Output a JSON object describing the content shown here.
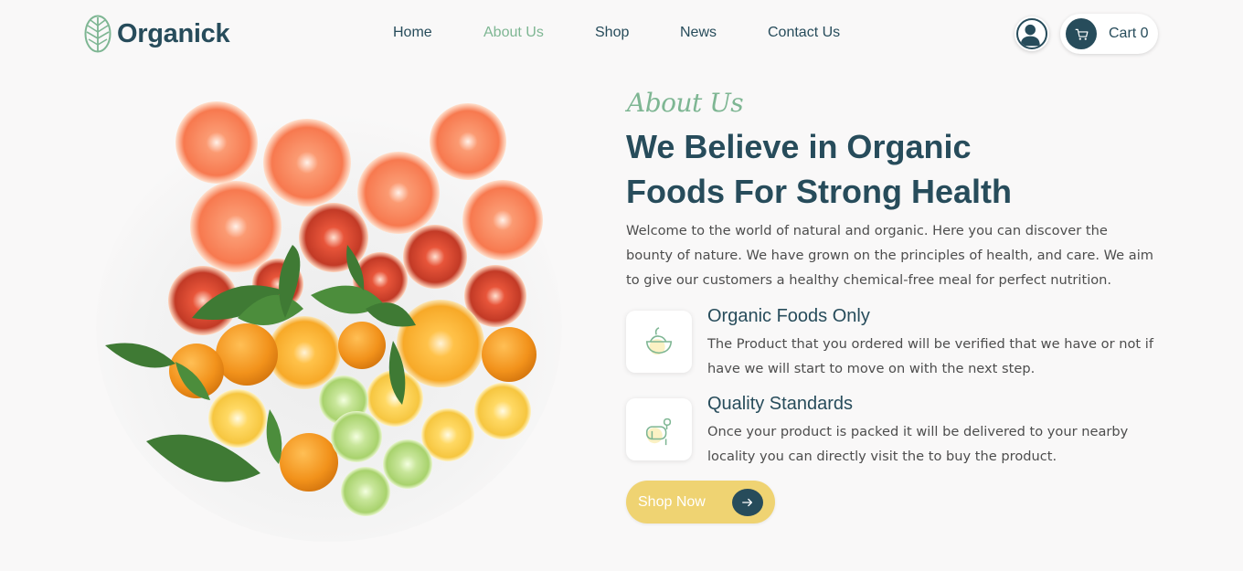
{
  "header": {
    "brand": "Organick",
    "nav": [
      {
        "label": "Home",
        "active": false
      },
      {
        "label": "About Us",
        "active": true
      },
      {
        "label": "Shop",
        "active": false
      },
      {
        "label": "News",
        "active": false
      },
      {
        "label": "Contact Us",
        "active": false
      }
    ],
    "cart_label": "Cart 0"
  },
  "about": {
    "subtitle": "About Us",
    "headline_line1": "We Believe in Organic",
    "headline_line2": "Foods For Strong Health",
    "intro": "Welcome to the world of natural and organic. Here you can discover the bounty of nature. We have grown on the principles of health, and care. We aim to give our customers a healthy chemical-free meal for perfect nutrition.",
    "features": [
      {
        "title": "Organic Foods Only",
        "description": "The Product that you ordered will be verified that we have or not if have we will start to move on with the next step.",
        "icon": "bowl-icon"
      },
      {
        "title": "Quality Standards",
        "description": "Once your product is packed it will be delivered to your nearby locality you can directly visit the to buy the product.",
        "icon": "mailbox-icon"
      }
    ],
    "cta_label": "Shop Now"
  },
  "colors": {
    "primary": "#274c5b",
    "accent_green": "#7eb693",
    "button_yellow": "#efd372",
    "background": "#f9f8f8"
  }
}
